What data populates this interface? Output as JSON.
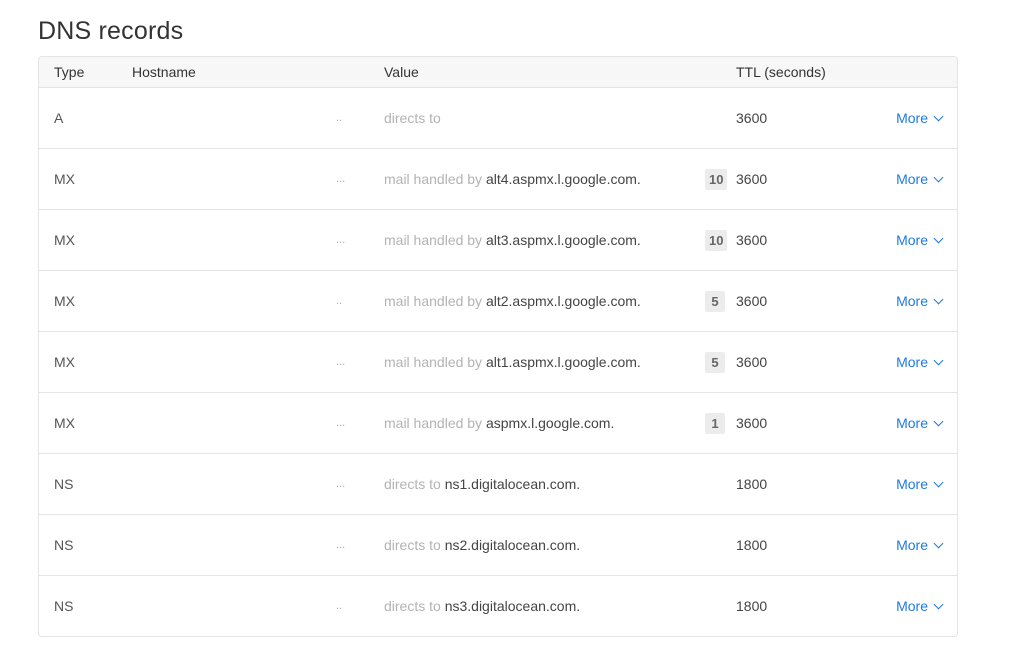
{
  "page": {
    "title": "DNS records"
  },
  "table": {
    "headers": {
      "type": "Type",
      "hostname": "Hostname",
      "value": "Value",
      "ttl": "TTL (seconds)"
    },
    "rows": [
      {
        "type": "A",
        "host": "..",
        "prefix": "directs to",
        "target": "",
        "priority": "",
        "ttl": "3600",
        "action": "More"
      },
      {
        "type": "MX",
        "host": "...",
        "prefix": "mail handled by",
        "target": "alt4.aspmx.l.google.com.",
        "priority": "10",
        "ttl": "3600",
        "action": "More"
      },
      {
        "type": "MX",
        "host": "...",
        "prefix": "mail handled by",
        "target": "alt3.aspmx.l.google.com.",
        "priority": "10",
        "ttl": "3600",
        "action": "More"
      },
      {
        "type": "MX",
        "host": "..",
        "prefix": "mail handled by",
        "target": "alt2.aspmx.l.google.com.",
        "priority": "5",
        "ttl": "3600",
        "action": "More"
      },
      {
        "type": "MX",
        "host": "...",
        "prefix": "mail handled by",
        "target": "alt1.aspmx.l.google.com.",
        "priority": "5",
        "ttl": "3600",
        "action": "More"
      },
      {
        "type": "MX",
        "host": "...",
        "prefix": "mail handled by",
        "target": "aspmx.l.google.com.",
        "priority": "1",
        "ttl": "3600",
        "action": "More"
      },
      {
        "type": "NS",
        "host": "...",
        "prefix": "directs to",
        "target": "ns1.digitalocean.com.",
        "priority": "",
        "ttl": "1800",
        "action": "More"
      },
      {
        "type": "NS",
        "host": "...",
        "prefix": "directs to",
        "target": "ns2.digitalocean.com.",
        "priority": "",
        "ttl": "1800",
        "action": "More"
      },
      {
        "type": "NS",
        "host": "..",
        "prefix": "directs to",
        "target": "ns3.digitalocean.com.",
        "priority": "",
        "ttl": "1800",
        "action": "More"
      }
    ]
  },
  "icons": {
    "more": "chevron-down-icon"
  },
  "colors": {
    "link": "#1f7ae0",
    "border": "#e4e4e4",
    "header_bg": "#f7f7f7"
  }
}
